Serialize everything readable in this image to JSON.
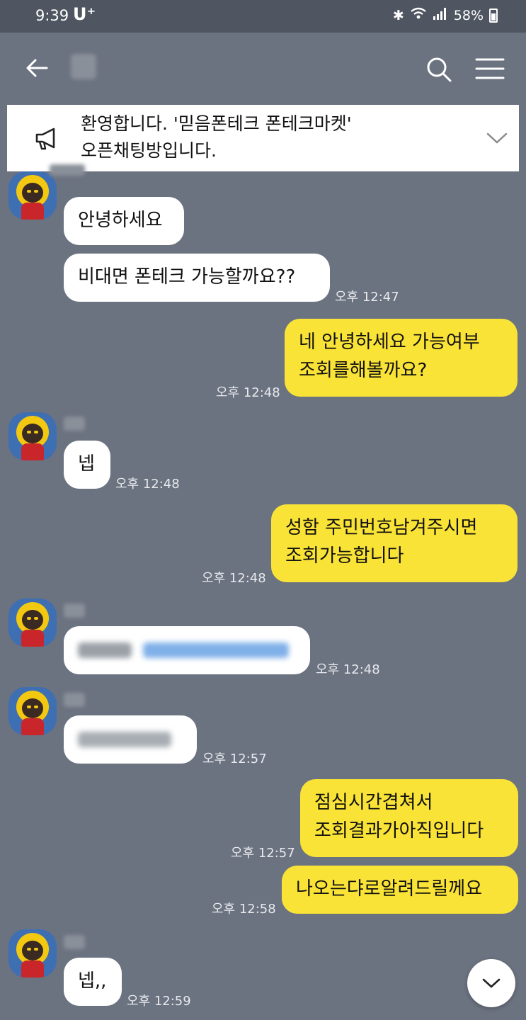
{
  "status_bar": {
    "time": "9:39",
    "carrier": "U⁺",
    "battery": "58%"
  },
  "notice": {
    "line1": "환영합니다. '믿음폰테크 폰테크마켓'",
    "line2": "오픈채팅방입니다."
  },
  "messages": [
    {
      "side": "in",
      "text": "안녕하세요"
    },
    {
      "side": "in",
      "text": "비대면 폰테크 가능할까요??",
      "time": "오후 12:47"
    },
    {
      "side": "out",
      "line1": "네 안녕하세요 가능여부",
      "line2": "조회를해볼까요?",
      "time": "오후 12:48"
    },
    {
      "side": "in",
      "text": "넵",
      "time": "오후 12:48"
    },
    {
      "side": "out",
      "line1": "성함 주민번호남겨주시면",
      "line2": "조회가능합니다",
      "time": "오후 12:48"
    },
    {
      "side": "in",
      "text": "",
      "time": "오후 12:48"
    },
    {
      "side": "in",
      "text": "",
      "time": "오후 12:57"
    },
    {
      "side": "out",
      "line1": "점심시간겹쳐서",
      "line2": "조회결과가아직입니다",
      "time": "오후 12:57"
    },
    {
      "side": "out",
      "text": "나오는댜로알려드릴께요",
      "time": "오후 12:58"
    },
    {
      "side": "in",
      "text": "넵,,",
      "time": "오후 12:59"
    }
  ],
  "colors": {
    "background": "#6b7280",
    "incoming_bubble": "#ffffff",
    "outgoing_bubble": "#fae337"
  },
  "icons": [
    "back-arrow-icon",
    "search-icon",
    "menu-icon",
    "megaphone-icon",
    "chevron-down-icon"
  ]
}
